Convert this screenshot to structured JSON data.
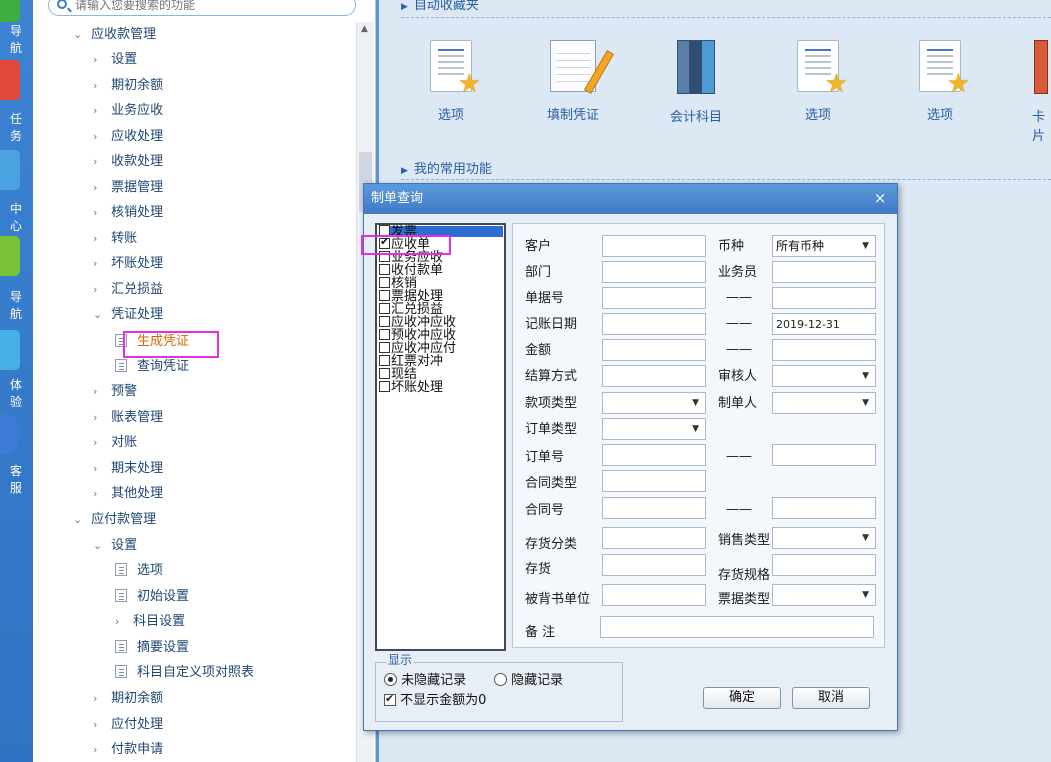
{
  "rail": {
    "items": [
      {
        "label": "导航",
        "icon": "nav-icon",
        "color": "#3cae3f"
      },
      {
        "label": "任务",
        "icon": "task-icon",
        "color": "#e2473a"
      },
      {
        "label": "中心",
        "icon": "center-icon",
        "color": "#4aa2e0"
      },
      {
        "label": "导航",
        "icon": "nav-green-icon",
        "color": "#7cc13a"
      },
      {
        "label": "体验",
        "icon": "experience-icon",
        "color": "#46b0e6"
      },
      {
        "label": "客服",
        "icon": "service-icon",
        "color": "#3c7cd8"
      }
    ]
  },
  "search": {
    "placeholder": "请输入您要搜索的功能"
  },
  "tree": {
    "receivable": {
      "label": "应收款管理",
      "items": [
        "设置",
        "期初余额",
        "业务应收",
        "应收处理",
        "收款处理",
        "票据管理",
        "核销处理",
        "转账",
        "坏账处理",
        "汇兑损益"
      ],
      "voucher": {
        "label": "凭证处理",
        "children": [
          "生成凭证",
          "查询凭证"
        ]
      },
      "after": [
        "预警",
        "账表管理",
        "对账",
        "期末处理",
        "其他处理"
      ]
    },
    "payable": {
      "label": "应付款管理",
      "settings": {
        "label": "设置",
        "children": [
          "选项",
          "初始设置"
        ],
        "subject": "科目设置",
        "more": [
          "摘要设置",
          "科目自定义项对照表"
        ]
      },
      "after": [
        "期初余额",
        "应付处理",
        "付款申请"
      ]
    }
  },
  "main": {
    "section1": "自动收藏夹",
    "section2": "我的常用功能",
    "icons": [
      {
        "label": "选项",
        "icon": "document-star-icon"
      },
      {
        "label": "填制凭证",
        "icon": "notepad-pencil-icon"
      },
      {
        "label": "会计科目",
        "icon": "books-icon"
      },
      {
        "label": "选项",
        "icon": "document-star-icon"
      },
      {
        "label": "选项",
        "icon": "document-star-icon"
      },
      {
        "label": "卡片",
        "icon": "card-book-icon"
      }
    ]
  },
  "dialog": {
    "title": "制单查询",
    "close": "×",
    "categories": [
      {
        "label": "发票",
        "checked": false
      },
      {
        "label": "应收单",
        "checked": true
      },
      {
        "label": "业务应收",
        "checked": false
      },
      {
        "label": "收付款单",
        "checked": false
      },
      {
        "label": "核销",
        "checked": false
      },
      {
        "label": "票据处理",
        "checked": false
      },
      {
        "label": "汇兑损益",
        "checked": false
      },
      {
        "label": "应收冲应收",
        "checked": false
      },
      {
        "label": "预收冲应收",
        "checked": false
      },
      {
        "label": "应收冲应付",
        "checked": false
      },
      {
        "label": "红票对冲",
        "checked": false
      },
      {
        "label": "现结",
        "checked": false
      },
      {
        "label": "坏账处理",
        "checked": false
      }
    ],
    "fields": {
      "customer": "客户",
      "currency": "币种",
      "currency_value": "所有币种",
      "department": "部门",
      "salesperson": "业务员",
      "doc_no": "单据号",
      "posting_date": "记账日期",
      "posting_date_to": "2019-12-31",
      "amount": "金额",
      "settlement": "结算方式",
      "reviewer": "审核人",
      "payment_type": "款项类型",
      "maker": "制单人",
      "order_type": "订单类型",
      "order_no": "订单号",
      "contract_type": "合同类型",
      "contract_no": "合同号",
      "inventory_class": "存货分类",
      "sales_type": "销售类型",
      "inventory": "存货",
      "inventory_spec": "存货规格",
      "endorser": "被背书单位",
      "bill_type": "票据类型",
      "remark": "备 注",
      "range_sep": "——"
    },
    "show": {
      "legend": "显示",
      "option1": "未隐藏记录",
      "option2": "隐藏记录",
      "zero": "不显示金额为0",
      "option1_selected": true,
      "zero_checked": true
    },
    "buttons": {
      "ok": "确定",
      "cancel": "取消"
    }
  },
  "colors": {
    "accent": "#3f7cc6",
    "annotation": "#e52ee0",
    "selected_text": "#d46a00"
  }
}
